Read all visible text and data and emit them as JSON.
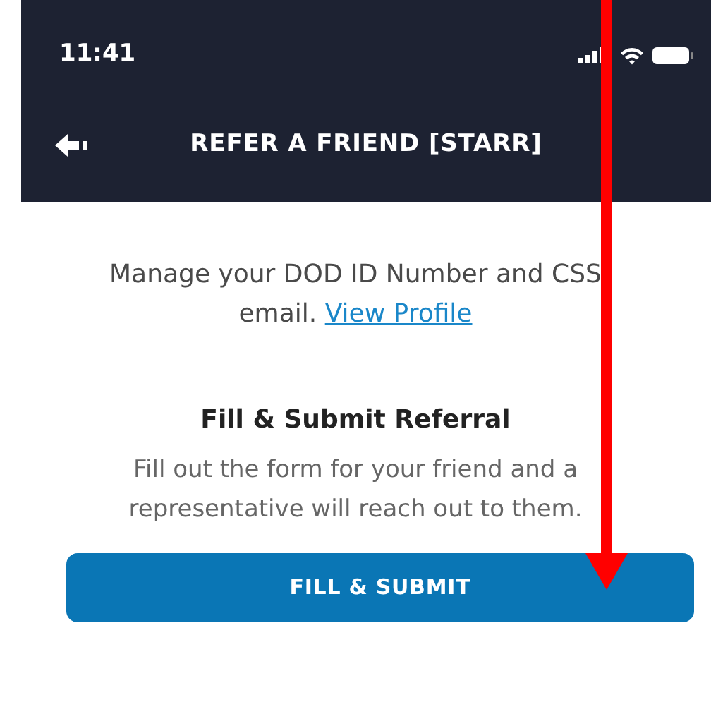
{
  "status_bar": {
    "time": "11:41"
  },
  "header": {
    "title": "REFER A FRIEND [STARR]"
  },
  "profile_note": {
    "text": "Manage your DOD ID Number and CSS email.",
    "link": "View Profile"
  },
  "referral": {
    "heading": "Fill & Submit Referral",
    "description": "Fill out the form for your friend and a representative will reach out to them."
  },
  "buttons": [
    "FILL & SUBMIT"
  ]
}
